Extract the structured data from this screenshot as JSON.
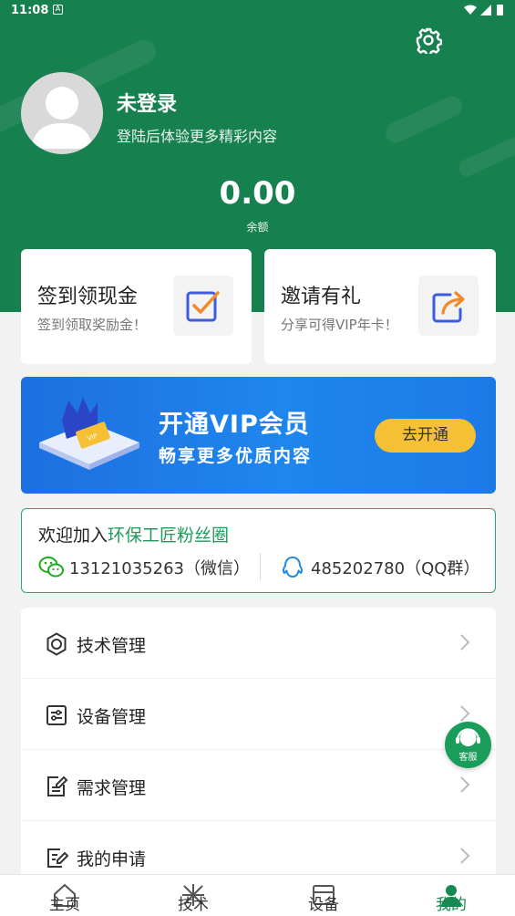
{
  "status_bar": {
    "time": "11:08",
    "a_badge": "A"
  },
  "profile": {
    "name": "未登录",
    "subtitle": "登陆后体验更多精彩内容",
    "balance": "0.00",
    "balance_label": "余额"
  },
  "cards": [
    {
      "title": "签到领现金",
      "subtitle": "签到领取奖励金！",
      "icon": "checkbox-icon"
    },
    {
      "title": "邀请有礼",
      "subtitle": "分享可得VIP年卡！",
      "icon": "share-arrow-icon"
    }
  ],
  "vip_banner": {
    "title": "开通VIP会员",
    "subtitle": "畅享更多优质内容",
    "button": "去开通",
    "card_text": "VIP"
  },
  "fans": {
    "title_prefix": "欢迎加入",
    "title_highlight": "环保工匠粉丝圈",
    "wechat": "13121035263（微信）",
    "qq": "485202780（QQ群）"
  },
  "menu": [
    {
      "label": "技术管理",
      "icon": "gear-outline-icon"
    },
    {
      "label": "设备管理",
      "icon": "equipment-icon"
    },
    {
      "label": "需求管理",
      "icon": "edit-note-icon"
    },
    {
      "label": "我的申请",
      "icon": "application-icon"
    }
  ],
  "service": {
    "label": "客服"
  },
  "tabs": [
    {
      "label": "主页",
      "icon": "home-icon"
    },
    {
      "label": "技术",
      "icon": "tech-icon"
    },
    {
      "label": "设备",
      "icon": "device-icon"
    },
    {
      "label": "我的",
      "icon": "person-icon",
      "active": true
    }
  ],
  "colors": {
    "primary_green": "#17804f",
    "vip_blue": "#1d6fe0",
    "vip_button": "#f6c034",
    "highlight_green": "#1e9b58"
  }
}
